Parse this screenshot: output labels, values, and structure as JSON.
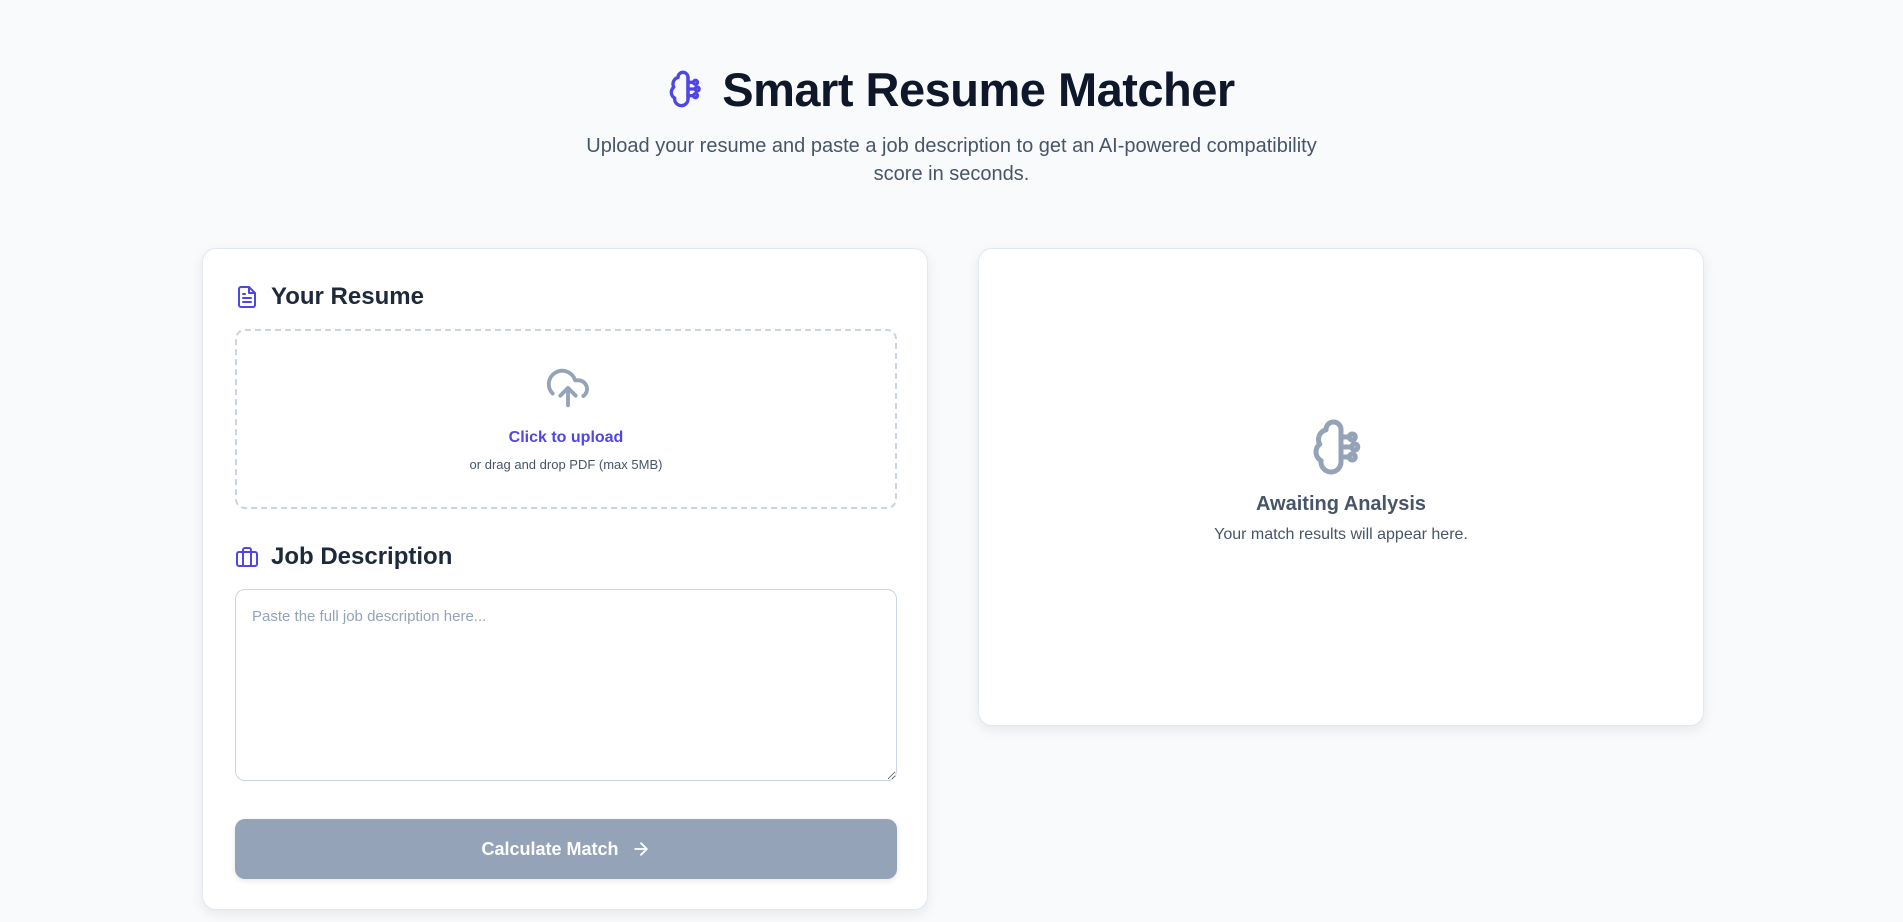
{
  "header": {
    "title": "Smart Resume Matcher",
    "subtitle": "Upload your resume and paste a job description to get an AI-powered compatibility score in seconds.",
    "icon": "brain-icon"
  },
  "resume": {
    "heading": "Your Resume",
    "icon": "file-text-icon",
    "upload": {
      "icon": "cloud-upload-icon",
      "cta": "Click to upload",
      "hint": "or drag and drop PDF (max 5MB)"
    }
  },
  "job": {
    "heading": "Job Description",
    "icon": "briefcase-icon",
    "placeholder": "Paste the full job description here...",
    "value": ""
  },
  "action": {
    "label": "Calculate Match",
    "icon": "arrow-right-icon",
    "state": "disabled"
  },
  "results": {
    "icon": "brain-icon",
    "status": "Awaiting Analysis",
    "message": "Your match results will appear here."
  },
  "colors": {
    "accent": "#4f46e5",
    "background": "#f8fafc",
    "muted": "#94a3b8",
    "text": "#0f172a",
    "button_disabled": "#94a3b8"
  }
}
